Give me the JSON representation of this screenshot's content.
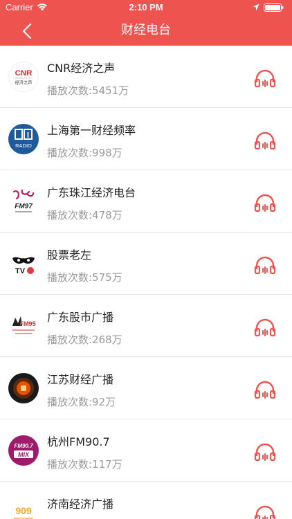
{
  "status_bar": {
    "carrier": "Carrier",
    "time": "2:10 PM",
    "icons": [
      "wifi-icon",
      "location-icon",
      "battery-icon"
    ]
  },
  "header": {
    "title": "财经电台",
    "back_icon": "chevron-left-icon"
  },
  "colors": {
    "accent": "#ef5350",
    "primary_text": "#222222",
    "secondary_text": "#9a9a9a",
    "divider": "#e6e6e6"
  },
  "stations": [
    {
      "name": "CNR经济之声",
      "plays": "播放次数:5451万",
      "logo_text": [
        "CNR",
        "经济之声"
      ]
    },
    {
      "name": "上海第一财经频率",
      "plays": "播放次数:998万",
      "logo_text": [
        "RADIO"
      ]
    },
    {
      "name": "广东珠江经济电台",
      "plays": "播放次数:478万",
      "logo_text": [
        "FM97"
      ]
    },
    {
      "name": "股票老左",
      "plays": "播放次数:575万",
      "logo_text": [
        "TV"
      ]
    },
    {
      "name": "广东股市广播",
      "plays": "播放次数:268万",
      "logo_text": [
        "FM95"
      ]
    },
    {
      "name": "江苏财经广播",
      "plays": "播放次数:92万",
      "logo_text": []
    },
    {
      "name": "杭州FM90.7",
      "plays": "播放次数:117万",
      "logo_text": [
        "FM90.7",
        "MIX"
      ]
    },
    {
      "name": "济南经济广播",
      "plays": "",
      "logo_text": [
        "909"
      ]
    }
  ]
}
